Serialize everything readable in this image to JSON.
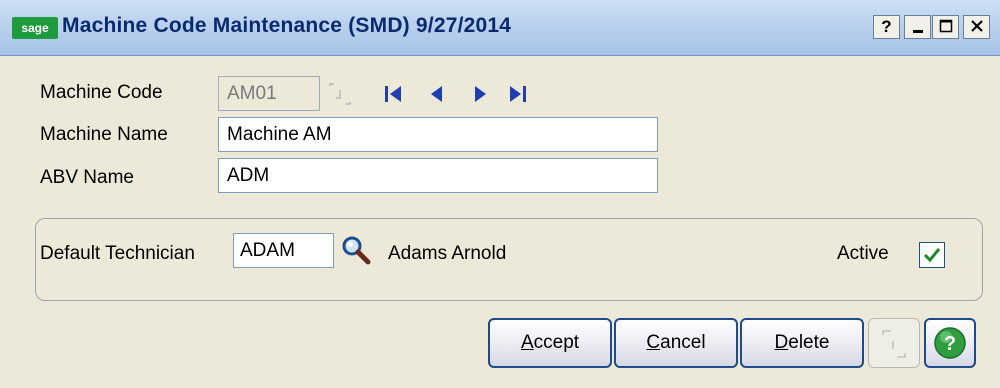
{
  "window": {
    "logo_text": "sage",
    "title": "Machine Code Maintenance (SMD) 9/27/2014",
    "help_label": "?"
  },
  "form": {
    "machine_code_label": "Machine Code",
    "machine_code_value": "AM01",
    "machine_name_label": "Machine Name",
    "machine_name_value": "Machine AM",
    "abv_name_label": "ABV Name",
    "abv_name_value": "ADM"
  },
  "technician": {
    "label": "Default Technician",
    "value": "ADAM",
    "name": "Adams Arnold",
    "active_label": "Active",
    "active_checked": true
  },
  "buttons": {
    "accept_prefix": "A",
    "accept_rest": "ccept",
    "cancel_prefix": "C",
    "cancel_rest": "ancel",
    "delete_prefix": "D",
    "delete_rest": "elete"
  },
  "colors": {
    "title_text": "#0b2a6e",
    "nav_blue": "#1f3fb0",
    "help_green": "#2e9e3f",
    "check_green": "#1a8a2b"
  }
}
